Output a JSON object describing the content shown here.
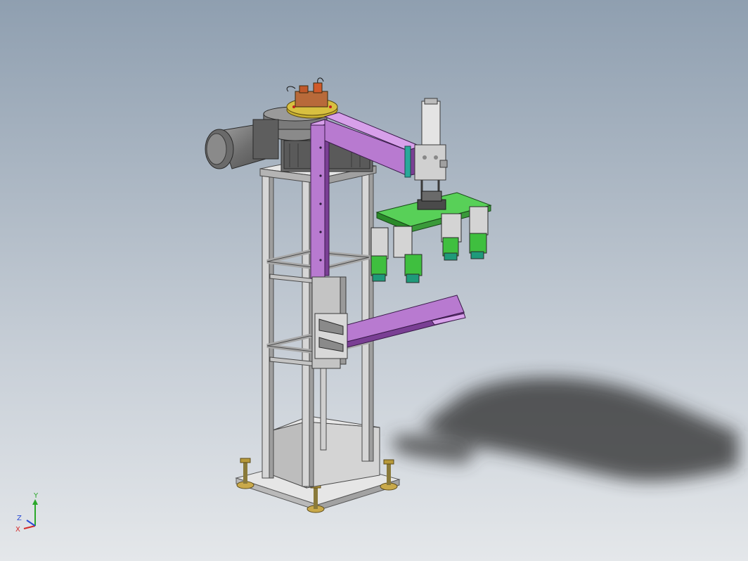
{
  "viewport": {
    "background_top": "#8f9fb0",
    "background_bottom": "#e4e7ea"
  },
  "model": {
    "colors": {
      "frame": "#c8c8c8",
      "frame_dark": "#8e8e8e",
      "arm": "#b87ad0",
      "arm_dark": "#8a4fa4",
      "gripper": "#3fbf3f",
      "gripper_dark": "#2a8a2a",
      "pad": "#1f9a7a",
      "motor": "#7a7a7a",
      "brass": "#b89a3a",
      "shadow": "#2a2a2a"
    }
  },
  "triad": {
    "x_label": "X",
    "y_label": "Y",
    "z_label": "Z",
    "x_color": "#d42a2a",
    "y_color": "#2aa82a",
    "z_color": "#2a4ad4"
  }
}
